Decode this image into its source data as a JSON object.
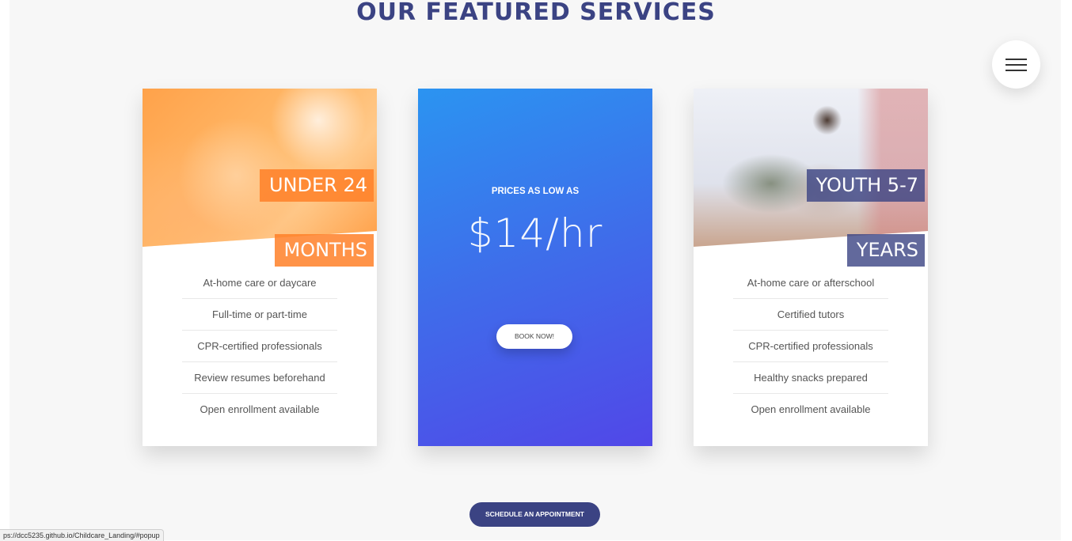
{
  "section": {
    "title": "OUR FEATURED SERVICES"
  },
  "menu": {
    "icon": "hamburger-menu-icon"
  },
  "cards": [
    {
      "image_label_lines": [
        "UNDER 24",
        "MONTHS"
      ],
      "accent": "#ff8a2a",
      "features": [
        "At-home care or daycare",
        "Full-time or part-time",
        "CPR-certified professionals",
        "Review resumes beforehand",
        "Open enrollment available"
      ]
    },
    {
      "price_label": "PRICES AS LOW AS",
      "price_value": "$14/hr",
      "button_label": "BOOK NOW!",
      "gradient": [
        "#2b94f1",
        "#5147e8"
      ]
    },
    {
      "image_label_lines": [
        "YOUTH 5-7",
        "YEARS"
      ],
      "accent": "#3b4383",
      "features": [
        "At-home care or afterschool",
        "Certified tutors",
        "CPR-certified professionals",
        "Healthy snacks prepared",
        "Open enrollment available"
      ]
    }
  ],
  "cta": {
    "label": "SCHEDULE AN APPOINTMENT",
    "color": "#3b4383"
  },
  "status_bar": {
    "url": "ps://dcc5235.github.io/Childcare_Landing/#popup"
  }
}
